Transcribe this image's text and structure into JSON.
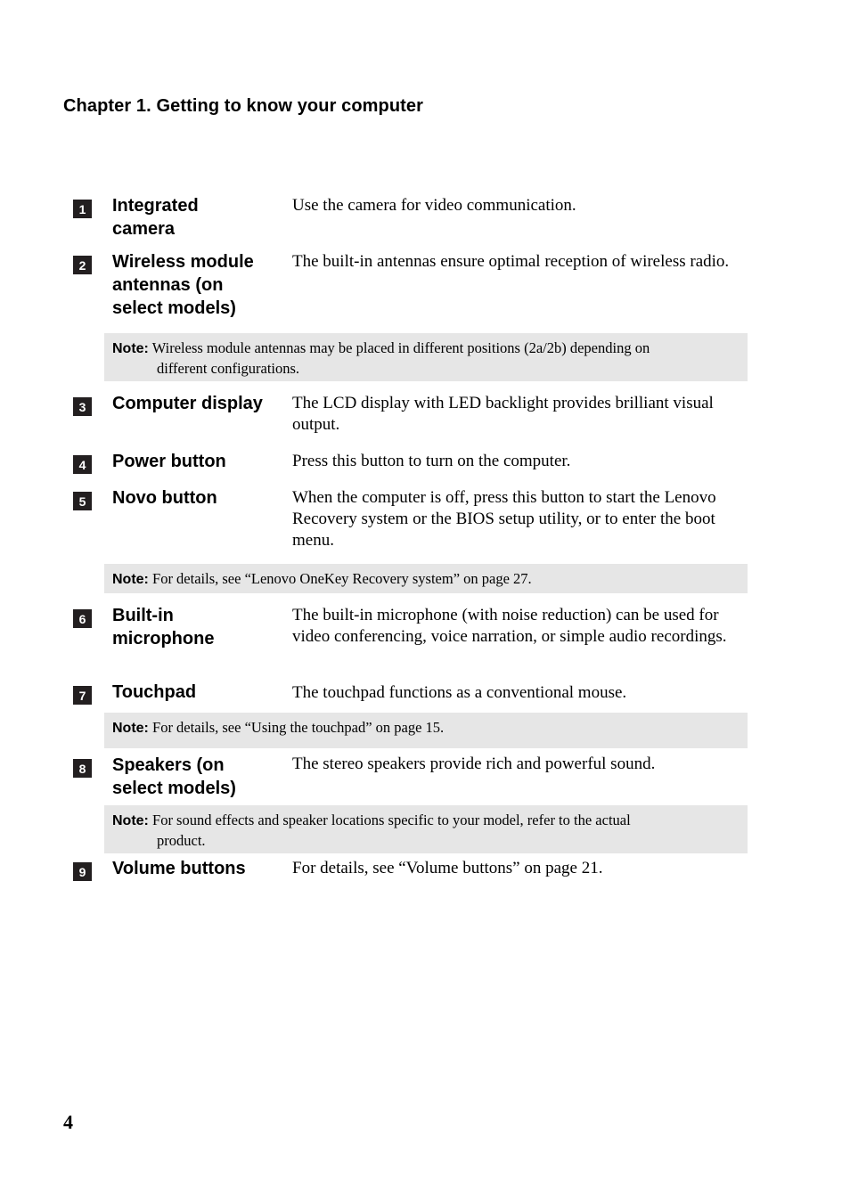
{
  "header": {
    "chapter_title": "Chapter 1. Getting to know your computer"
  },
  "items": [
    {
      "number": "1",
      "term": "Integrated camera",
      "term_lines": [
        "Integrated",
        "camera"
      ],
      "description": "Use the camera for video communication."
    },
    {
      "number": "2",
      "term": "Wireless module antennas (on select models)",
      "term_lines": [
        "Wireless module",
        "antennas (on",
        "select models)"
      ],
      "description": "The built-in antennas ensure optimal reception of wireless radio."
    },
    {
      "number": "3",
      "term": "Computer display",
      "term_lines": [
        "Computer display"
      ],
      "description": "The LCD display with LED backlight provides brilliant visual output."
    },
    {
      "number": "4",
      "term": "Power button",
      "term_lines": [
        "Power button"
      ],
      "description": "Press this button to turn on the computer."
    },
    {
      "number": "5",
      "term": "Novo button",
      "term_lines": [
        "Novo button"
      ],
      "description": "When the computer is off, press this button to start the Lenovo Recovery system or the BIOS setup utility, or to enter the boot menu."
    },
    {
      "number": "6",
      "term": "Built-in microphone",
      "term_lines": [
        "Built-in",
        "microphone"
      ],
      "description": "The built-in microphone (with noise reduction) can be used for video conferencing, voice narration, or simple audio recordings."
    },
    {
      "number": "7",
      "term": "Touchpad",
      "term_lines": [
        "Touchpad"
      ],
      "description": "The touchpad functions as a conventional mouse."
    },
    {
      "number": "8",
      "term": "Speakers (on select models)",
      "term_lines": [
        "Speakers (on",
        "select models)"
      ],
      "description": "The stereo speakers provide rich and powerful sound."
    },
    {
      "number": "9",
      "term": "Volume buttons",
      "term_lines": [
        "Volume buttons"
      ],
      "description": "For details, see “Volume buttons” on page 21."
    }
  ],
  "notes": [
    {
      "label": "Note:",
      "text_line1": " Wireless module antennas may be placed in different positions (2a/2b) depending on",
      "text_line2": "different configurations."
    },
    {
      "label": "Note:",
      "text_line1": " For details, see “Lenovo OneKey Recovery system” on page 27.",
      "text_line2": ""
    },
    {
      "label": "Note:",
      "text_line1": " For details, see “Using the touchpad” on page 15.",
      "text_line2": ""
    },
    {
      "label": "Note:",
      "text_line1": " For sound effects and speaker locations specific to your model, refer to the actual",
      "text_line2": "product."
    }
  ],
  "footer": {
    "page_number": "4"
  }
}
